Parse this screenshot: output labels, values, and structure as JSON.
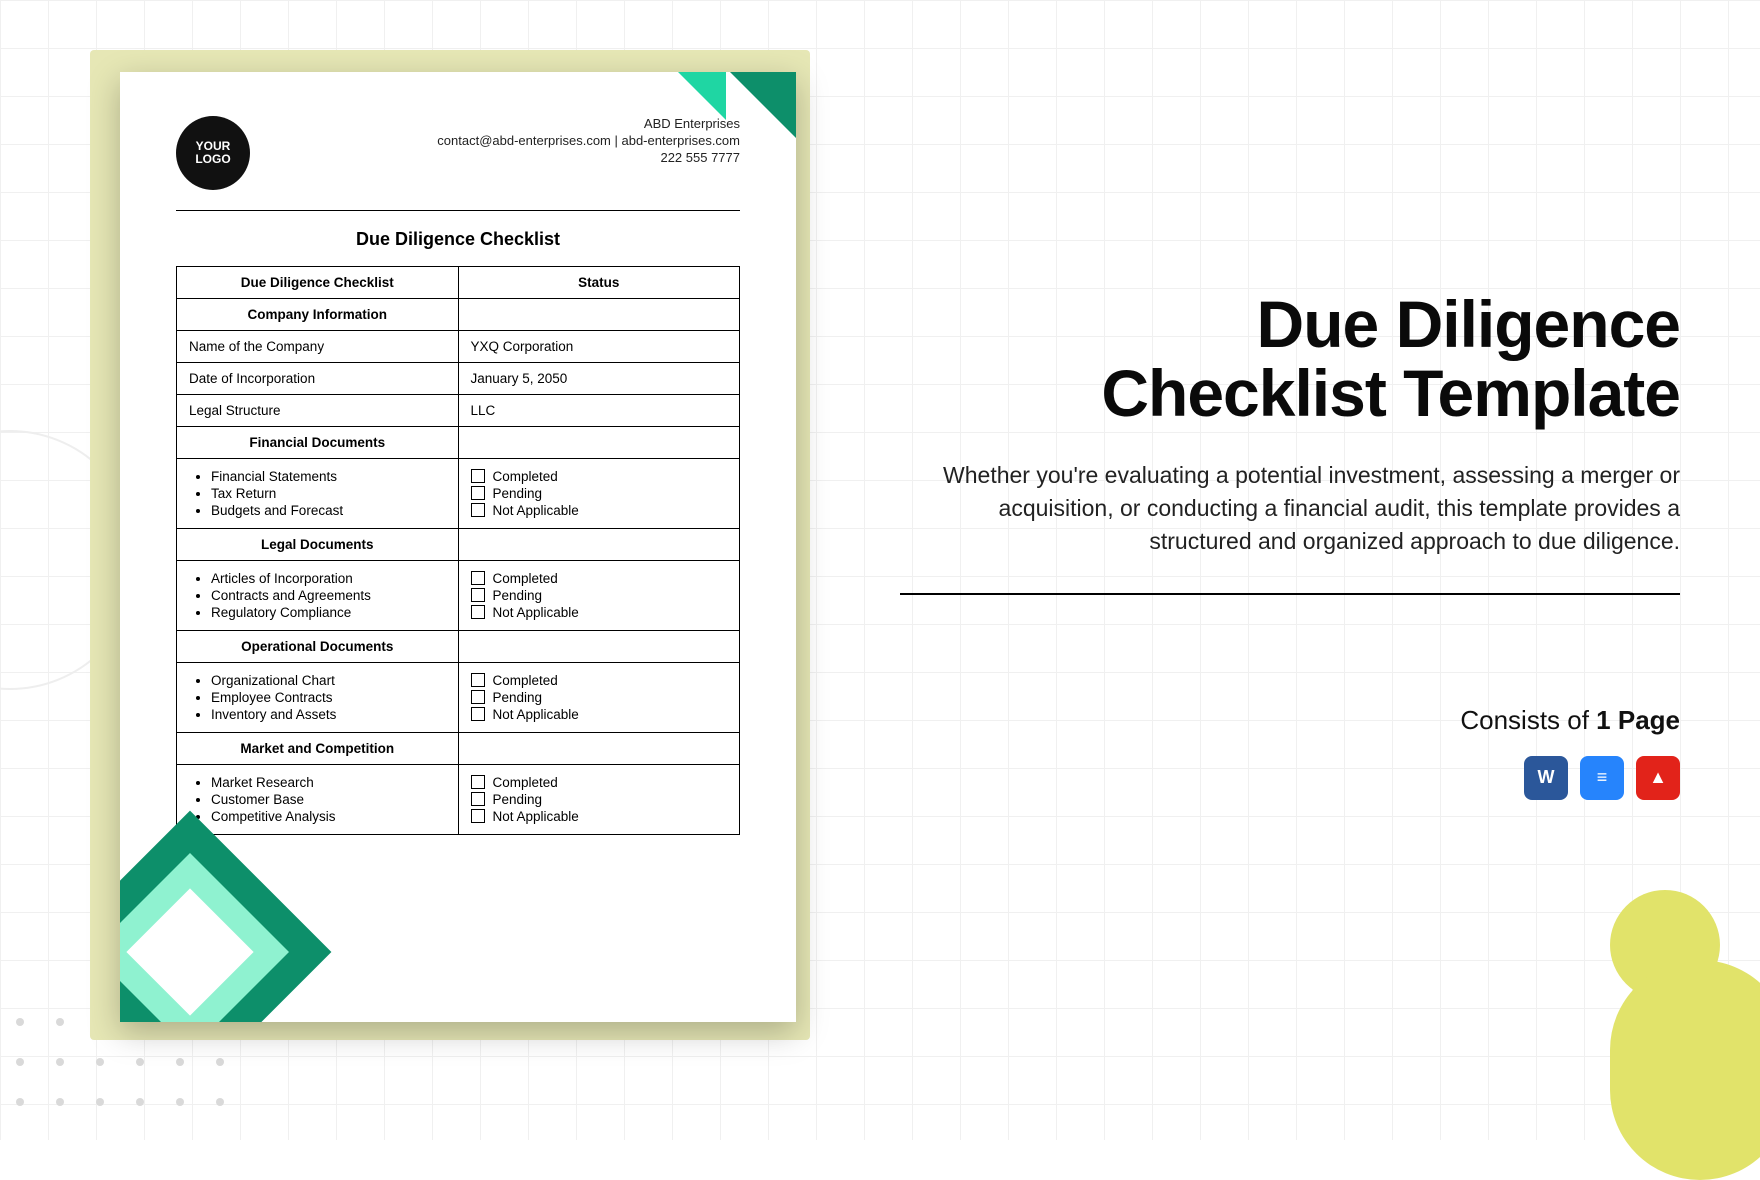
{
  "preview": {
    "logo_text": "YOUR\nLOGO",
    "company": {
      "name": "ABD Enterprises",
      "contact_line": "contact@abd-enterprises.com | abd-enterprises.com",
      "phone": "222 555 7777"
    },
    "doc_title": "Due Diligence Checklist",
    "table": {
      "header_left": "Due Diligence Checklist",
      "header_right": "Status",
      "section1": "Company Information",
      "row_company_name_label": "Name of the Company",
      "row_company_name_value": "YXQ Corporation",
      "row_date_label": "Date of Incorporation",
      "row_date_value": "January 5, 2050",
      "row_legal_label": "Legal Structure",
      "row_legal_value": "LLC",
      "section2": "Financial Documents",
      "fin_items": [
        "Financial Statements",
        "Tax Return",
        "Budgets and Forecast"
      ],
      "section3": "Legal Documents",
      "legal_items": [
        "Articles of Incorporation",
        "Contracts and Agreements",
        "Regulatory Compliance"
      ],
      "section4": "Operational Documents",
      "ops_items": [
        "Organizational Chart",
        "Employee Contracts",
        "Inventory and Assets"
      ],
      "section5": "Market and Competition",
      "mkt_items": [
        "Market Research",
        "Customer Base",
        "Competitive Analysis"
      ],
      "status_options": [
        "Completed",
        "Pending",
        "Not Applicable"
      ]
    }
  },
  "promo": {
    "title_line1": "Due Diligence",
    "title_line2": "Checklist Template",
    "description": "Whether you're evaluating a potential investment, assessing a merger or acquisition, or conducting a financial audit, this template provides a structured and organized approach to due diligence.",
    "consists_prefix": "Consists of ",
    "consists_bold": "1 Page",
    "icons": {
      "word": "W",
      "gdoc": "≡",
      "pdf": "▲"
    }
  }
}
